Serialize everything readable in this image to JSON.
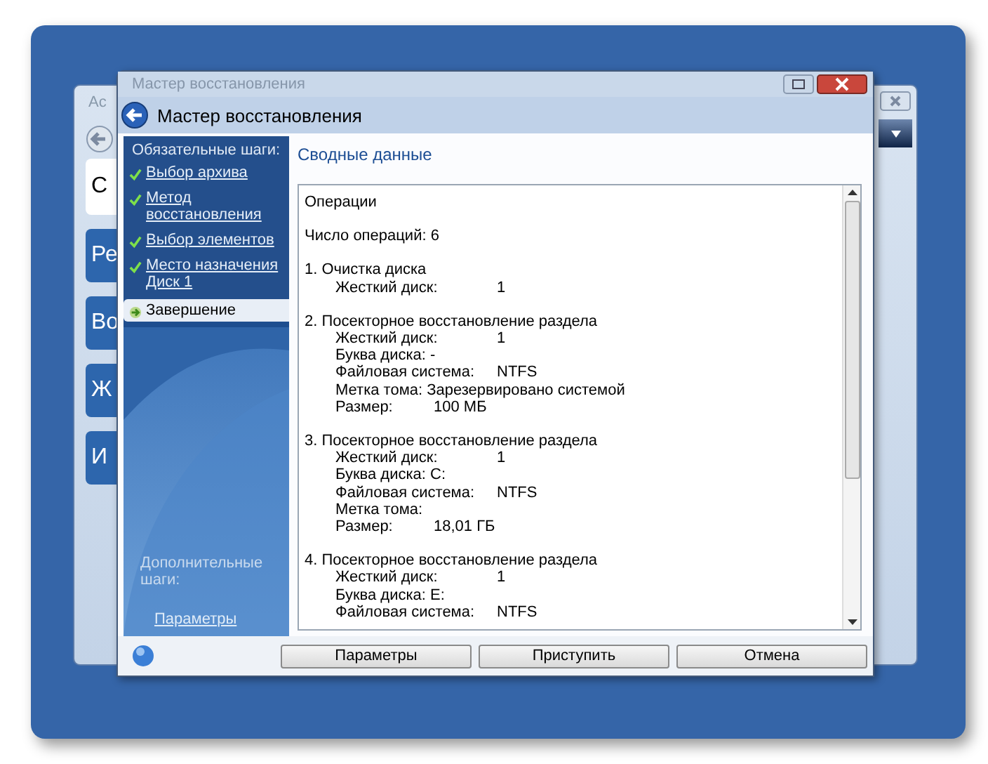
{
  "back_window": {
    "title": "Ac",
    "tiles": [
      {
        "label": "С",
        "selected": true
      },
      {
        "label": "Ре",
        "selected": false
      },
      {
        "label": "Во",
        "selected": false
      },
      {
        "label": "Ж",
        "selected": false
      },
      {
        "label": "И",
        "selected": false
      }
    ]
  },
  "window": {
    "title": "Мастер восстановления",
    "header": "Мастер восстановления"
  },
  "sidebar": {
    "required_title": "Обязательные шаги:",
    "steps": [
      {
        "label": "Выбор архива",
        "done": true,
        "selected": false
      },
      {
        "label": "Метод восстановления",
        "done": true,
        "selected": false
      },
      {
        "label": "Выбор элементов",
        "done": true,
        "selected": false
      },
      {
        "label": "Место назначения Диск 1",
        "done": true,
        "selected": false
      },
      {
        "label": "Завершение",
        "done": false,
        "selected": true
      }
    ],
    "optional_title": "Дополнительные шаги:",
    "optional_link": "Параметры"
  },
  "content": {
    "title": "Сводные данные",
    "lines": [
      {
        "kind": "plain",
        "label": "Операции"
      },
      {
        "kind": "plain",
        "label": "Число операций: 6"
      },
      {
        "kind": "heading",
        "label": "1. Очистка диска"
      },
      {
        "kind": "wide",
        "label": "Жесткий диск:",
        "value": "1"
      },
      {
        "kind": "heading",
        "label": "2. Посекторное восстановление раздела"
      },
      {
        "kind": "wide",
        "label": "Жесткий диск:",
        "value": "1"
      },
      {
        "kind": "detail",
        "label": "Буква диска: -"
      },
      {
        "kind": "wide",
        "label": "Файловая система:",
        "value": "NTFS"
      },
      {
        "kind": "detail",
        "label": "Метка тома:  Зарезервировано системой"
      },
      {
        "kind": "short",
        "label": "Размер:",
        "value": "100 МБ"
      },
      {
        "kind": "heading",
        "label": "3. Посекторное восстановление раздела"
      },
      {
        "kind": "wide",
        "label": "Жесткий диск:",
        "value": "1"
      },
      {
        "kind": "detail",
        "label": "Буква диска: C:"
      },
      {
        "kind": "wide",
        "label": "Файловая система:",
        "value": "NTFS"
      },
      {
        "kind": "detail",
        "label": "Метка тома:"
      },
      {
        "kind": "short",
        "label": "Размер:",
        "value": "18,01 ГБ"
      },
      {
        "kind": "heading",
        "label": "4. Посекторное восстановление раздела"
      },
      {
        "kind": "wide",
        "label": "Жесткий диск:",
        "value": "1"
      },
      {
        "kind": "detail",
        "label": "Буква диска: E:"
      },
      {
        "kind": "wide",
        "label": "Файловая система:",
        "value": "NTFS"
      }
    ]
  },
  "buttons": [
    "Параметры",
    "Приступить",
    "Отмена"
  ]
}
